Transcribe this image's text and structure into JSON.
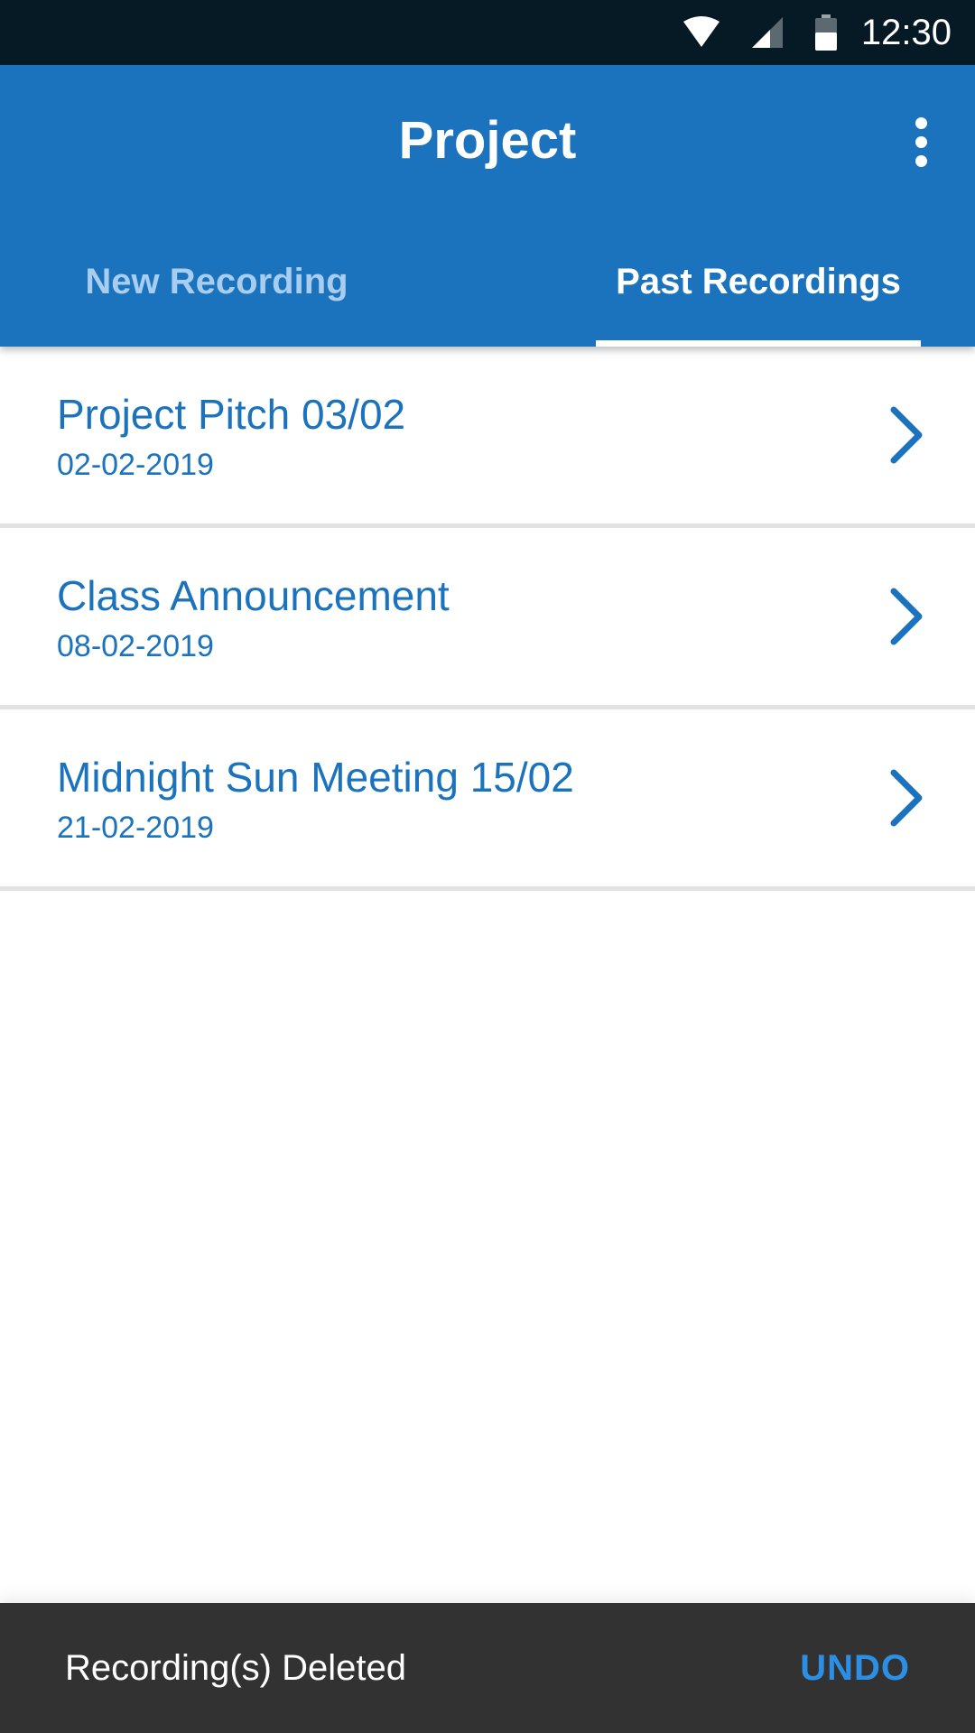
{
  "status_bar": {
    "time": "12:30",
    "icons": [
      "wifi-icon",
      "cell-signal-icon",
      "battery-icon"
    ]
  },
  "app_bar": {
    "title": "Project",
    "overflow_icon": "more-vert-icon",
    "background_color": "#1c73bd"
  },
  "tabs": [
    {
      "label": "New Recording",
      "selected": false
    },
    {
      "label": "Past Recordings",
      "selected": true
    }
  ],
  "recordings": [
    {
      "title": "Project Pitch 03/02",
      "date": "02-02-2019"
    },
    {
      "title": "Class Announcement",
      "date": "08-02-2019"
    },
    {
      "title": "Midnight Sun Meeting 15/02",
      "date": "21-02-2019"
    }
  ],
  "snackbar": {
    "message": "Recording(s) Deleted",
    "action": "UNDO",
    "action_color": "#2b8fe6"
  }
}
